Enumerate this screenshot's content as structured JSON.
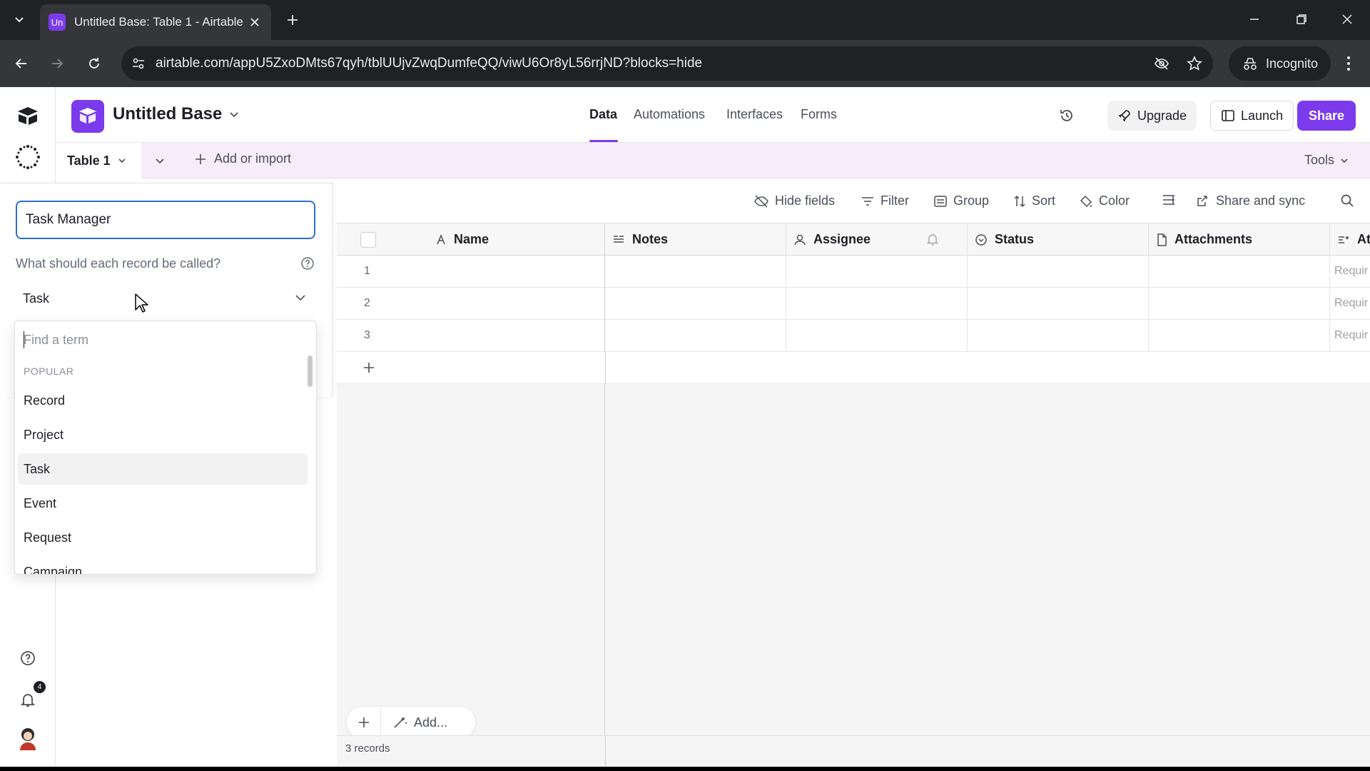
{
  "browser": {
    "tab_favicon_text": "Un",
    "tab_title": "Untitled Base: Table 1 - Airtable",
    "url": "airtable.com/appU5ZxoDMts67qyh/tblUUjvZwqDumfeQQ/viwU6Or8yL56rrjND?blocks=hide",
    "incognito_label": "Incognito"
  },
  "app": {
    "base_name": "Untitled Base",
    "nav_tabs": [
      {
        "label": "Data",
        "active": true
      },
      {
        "label": "Automations",
        "active": false
      },
      {
        "label": "Interfaces",
        "active": false
      },
      {
        "label": "Forms",
        "active": false
      }
    ],
    "upgrade_label": "Upgrade",
    "launch_label": "Launch",
    "share_label": "Share",
    "accent_color": "#7c3aed",
    "notification_count": "4"
  },
  "table_bar": {
    "table_name": "Table 1",
    "add_import_label": "Add or import",
    "tools_label": "Tools"
  },
  "panel": {
    "name_value": "Task Manager",
    "question": "What should each record be called?",
    "selected_term": "Task",
    "search_placeholder": "Find a term",
    "section_label": "POPULAR",
    "options": [
      "Record",
      "Project",
      "Task",
      "Event",
      "Request",
      "Campaign"
    ],
    "highlighted_option": "Task"
  },
  "view_toolbar": {
    "hide_fields": "Hide fields",
    "filter": "Filter",
    "group": "Group",
    "sort": "Sort",
    "color": "Color",
    "share_sync": "Share and sync"
  },
  "grid": {
    "columns": [
      "Name",
      "Notes",
      "Assignee",
      "Status",
      "Attachments",
      "Att"
    ],
    "row_numbers": [
      "1",
      "2",
      "3"
    ],
    "truncated_cell_text": "Requir",
    "add_label": "Add...",
    "record_count": "3 records"
  }
}
